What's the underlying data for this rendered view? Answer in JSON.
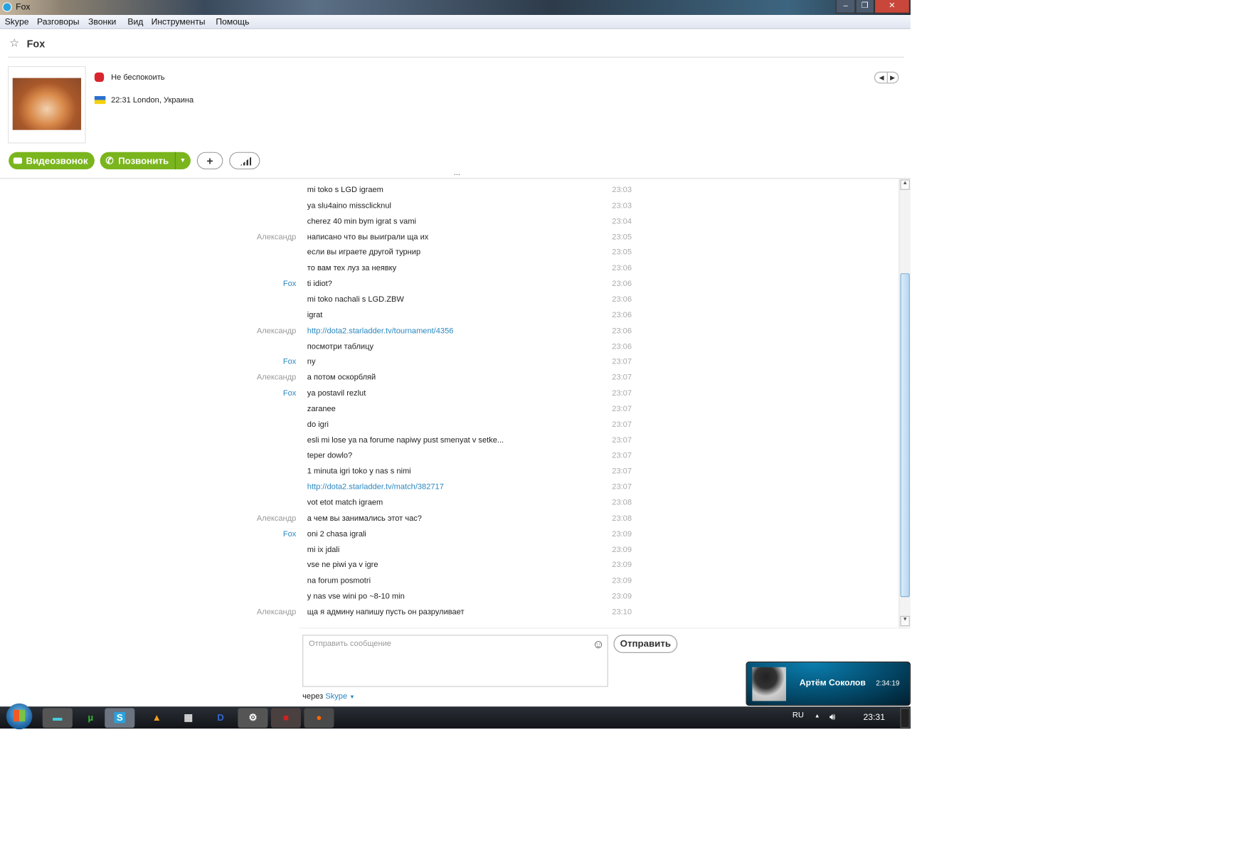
{
  "window": {
    "title": "Fox",
    "controls": [
      "–",
      "❐",
      "✕"
    ]
  },
  "menu": [
    "Skype",
    "Разговоры",
    "Звонки",
    "Вид",
    "Инструменты",
    "Помощь"
  ],
  "contact": {
    "name": "Fox",
    "status": "Не беспокоить",
    "location": "22:31 London, Украина"
  },
  "actions": {
    "video": "Видеозвонок",
    "call": "Позвонить",
    "add": "+",
    "signal": "signal-bars-icon"
  },
  "more": "...",
  "messages": [
    {
      "sender": "",
      "text": "mi toko s LGD igraem",
      "time": "23:03"
    },
    {
      "sender": "",
      "text": "ya slu4aino missclicknul",
      "time": "23:03"
    },
    {
      "sender": "",
      "text": "cherez 40 min bym igrat s vami",
      "time": "23:04"
    },
    {
      "sender": "Александр",
      "text": "написано что вы выиграли ща их",
      "time": "23:05"
    },
    {
      "sender": "",
      "text": "если вы играете другой турнир",
      "time": "23:05"
    },
    {
      "sender": "",
      "text": "то вам тех луз за неявку",
      "time": "23:06"
    },
    {
      "sender": "Fox",
      "text": "ti idiot?",
      "time": "23:06"
    },
    {
      "sender": "",
      "text": "mi toko nachali s LGD.ZBW",
      "time": "23:06"
    },
    {
      "sender": "",
      "text": "igrat",
      "time": "23:06"
    },
    {
      "sender": "Александр",
      "text": "http://dota2.starladder.tv/tournament/4356",
      "time": "23:06",
      "link": true
    },
    {
      "sender": "",
      "text": "посмотри таблицу",
      "time": "23:06"
    },
    {
      "sender": "Fox",
      "text": "ny",
      "time": "23:07"
    },
    {
      "sender": "Александр",
      "text": "а потом оскорбляй",
      "time": "23:07"
    },
    {
      "sender": "Fox",
      "text": "ya postavil rezlut",
      "time": "23:07"
    },
    {
      "sender": "",
      "text": "zaranee",
      "time": "23:07"
    },
    {
      "sender": "",
      "text": "do igri",
      "time": "23:07"
    },
    {
      "sender": "",
      "text": "esli mi lose ya na forume napiwy pust smenyat v setke...",
      "time": "23:07"
    },
    {
      "sender": "",
      "text": "teper dowlo?",
      "time": "23:07"
    },
    {
      "sender": "",
      "text": "1 minuta igri toko y nas s nimi",
      "time": "23:07"
    },
    {
      "sender": "",
      "text": "http://dota2.starladder.tv/match/382717",
      "time": "23:07",
      "link": true
    },
    {
      "sender": "",
      "text": "vot etot match igraem",
      "time": "23:08"
    },
    {
      "sender": "Александр",
      "text": "а чем вы занимались этот час?",
      "time": "23:08"
    },
    {
      "sender": "Fox",
      "text": "oni 2 chasa igrali",
      "time": "23:09"
    },
    {
      "sender": "",
      "text": "mi ix jdali",
      "time": "23:09"
    },
    {
      "sender": "",
      "text": "vse ne  piwi ya v igre",
      "time": "23:09"
    },
    {
      "sender": "",
      "text": "na forum posmotri",
      "time": "23:09"
    },
    {
      "sender": "",
      "text": "y nas vse wini po ~8-10 min",
      "time": "23:09"
    },
    {
      "sender": "Александр",
      "text": "ща я админу напишу пусть он разруливает",
      "time": "23:10"
    }
  ],
  "composer": {
    "placeholder": "Отправить сообщение",
    "send": "Отправить",
    "via": "через",
    "via_service": "Skype"
  },
  "notification": {
    "name": "Артём Соколов",
    "time": "2:34:19"
  },
  "tray": {
    "lang": "RU",
    "clock": "23:31"
  },
  "colors": {
    "green": "#7ab51d",
    "link": "#2a87c0"
  }
}
